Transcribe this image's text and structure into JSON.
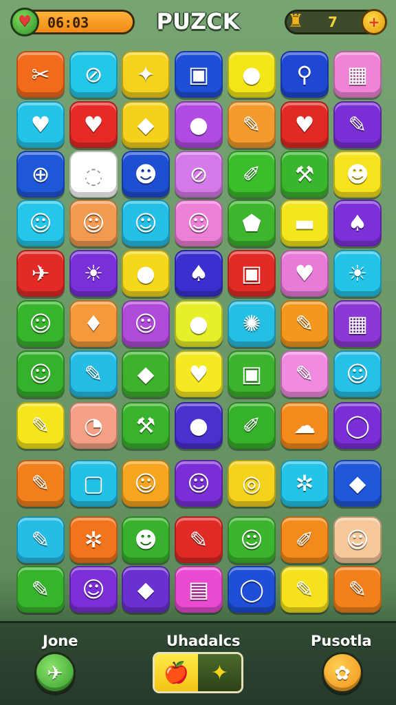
{
  "header": {
    "timer": "06:03",
    "title": "PUZCK",
    "count": "7",
    "heart_icon": "heart-icon",
    "trophy_icon": "trophy-icon",
    "plus_icon": "plus-icon"
  },
  "board": {
    "rows": [
      [
        {
          "c": "#f26b1d",
          "g": "✂"
        },
        {
          "c": "#23c7e8",
          "g": "⊘"
        },
        {
          "c": "#f5d21e",
          "g": "✦"
        },
        {
          "c": "#1f4fd6",
          "g": "▣"
        },
        {
          "c": "#f2e619",
          "g": "●"
        },
        {
          "c": "#1e48d2",
          "g": "⚲"
        },
        {
          "c": "#f083d6",
          "g": "▦"
        }
      ],
      [
        {
          "c": "#24c4e8",
          "g": "♥"
        },
        {
          "c": "#e62a26",
          "g": "♥"
        },
        {
          "c": "#f4d11c",
          "g": "◆"
        },
        {
          "c": "#b14ae0",
          "g": "●"
        },
        {
          "c": "#f59a2c",
          "g": "✎"
        },
        {
          "c": "#e12a24",
          "g": "♥"
        },
        {
          "c": "#7a2fd6",
          "g": "✎"
        }
      ],
      [
        {
          "c": "#1e57d8",
          "g": "⊕"
        },
        {
          "c": "#ffffff",
          "g": "◌"
        },
        {
          "c": "#1e4fd3",
          "g": "☻"
        },
        {
          "c": "#d47ae8",
          "g": "⊘"
        },
        {
          "c": "#3bbd2c",
          "g": "✐"
        },
        {
          "c": "#3ab62e",
          "g": "⚒"
        },
        {
          "c": "#f5e31e",
          "g": "☻"
        }
      ],
      [
        {
          "c": "#24c6ea",
          "g": "☺"
        },
        {
          "c": "#f39a52",
          "g": "☺"
        },
        {
          "c": "#23bfe6",
          "g": "☺"
        },
        {
          "c": "#ee7fd7",
          "g": "☺"
        },
        {
          "c": "#3db52d",
          "g": "⬟"
        },
        {
          "c": "#f3e61c",
          "g": "▬"
        },
        {
          "c": "#7b30d8",
          "g": "♠"
        }
      ],
      [
        {
          "c": "#e22a26",
          "g": "✈"
        },
        {
          "c": "#7a30d8",
          "g": "☀"
        },
        {
          "c": "#f5d71c",
          "g": "●"
        },
        {
          "c": "#3b2fd0",
          "g": "♠"
        },
        {
          "c": "#e32b26",
          "g": "▣"
        },
        {
          "c": "#e87ad8",
          "g": "♥"
        },
        {
          "c": "#24c3e8",
          "g": "☀"
        }
      ],
      [
        {
          "c": "#36b42c",
          "g": "☺"
        },
        {
          "c": "#f49a3a",
          "g": "♦"
        },
        {
          "c": "#b04bd9",
          "g": "☺"
        },
        {
          "c": "#e7ef2a",
          "g": "●"
        },
        {
          "c": "#26bfe4",
          "g": "✺"
        },
        {
          "c": "#f3981c",
          "g": "✎"
        },
        {
          "c": "#8c38d6",
          "g": "▦"
        }
      ],
      [
        {
          "c": "#35b12b",
          "g": "☺"
        },
        {
          "c": "#25bde6",
          "g": "✎"
        },
        {
          "c": "#3fb22d",
          "g": "◆"
        },
        {
          "c": "#f5ea22",
          "g": "♥"
        },
        {
          "c": "#3cb32c",
          "g": "▣"
        },
        {
          "c": "#f08be0",
          "g": "✎"
        },
        {
          "c": "#25c1e8",
          "g": "☺"
        }
      ],
      [
        {
          "c": "#f5e51c",
          "g": "✎"
        },
        {
          "c": "#f5a187",
          "g": "◔"
        },
        {
          "c": "#39b32c",
          "g": "⚒"
        },
        {
          "c": "#4a30cf",
          "g": "●"
        },
        {
          "c": "#35b22a",
          "g": "✐"
        },
        {
          "c": "#f38a1c",
          "g": "☁"
        },
        {
          "c": "#7a2fd6",
          "g": "◯"
        }
      ],
      [
        {
          "c": "#f2801c",
          "g": "✎"
        },
        {
          "c": "#24c1e6",
          "g": "▢"
        },
        {
          "c": "#f5a51e",
          "g": "☺"
        },
        {
          "c": "#7a2fd6",
          "g": "☺"
        },
        {
          "c": "#f5d21c",
          "g": "◎"
        },
        {
          "c": "#24c4e8",
          "g": "✲"
        },
        {
          "c": "#1f57d8",
          "g": "◆"
        }
      ],
      [
        {
          "c": "#25bde6",
          "g": "✎"
        },
        {
          "c": "#f2741c",
          "g": "✲"
        },
        {
          "c": "#38b22c",
          "g": "☻"
        },
        {
          "c": "#e02a26",
          "g": "✎"
        },
        {
          "c": "#3bb52d",
          "g": "☺"
        },
        {
          "c": "#f38a1c",
          "g": "✐"
        },
        {
          "c": "#f5c89a",
          "g": "☺"
        }
      ],
      [
        {
          "c": "#38b42c",
          "g": "✎"
        },
        {
          "c": "#7c2fd6",
          "g": "☺"
        },
        {
          "c": "#6a30d0",
          "g": "◆"
        },
        {
          "c": "#e84ad0",
          "g": "▤"
        },
        {
          "c": "#1e4fd6",
          "g": "◯"
        },
        {
          "c": "#f5e21c",
          "g": "✎"
        },
        {
          "c": "#f2801c",
          "g": "✎"
        }
      ]
    ]
  },
  "footer": {
    "left_label": "Jone",
    "center_label": "Uhadalcs",
    "right_label": "Pusotla",
    "left_icon": "paper-plane-icon",
    "center_left_icon": "apple-icon",
    "center_right_icon": "sparkle-wand-icon",
    "right_icon": "flower-icon",
    "left_glyph": "✈",
    "center_left_glyph": "🍎",
    "center_right_glyph": "✦",
    "right_glyph": "✿"
  }
}
